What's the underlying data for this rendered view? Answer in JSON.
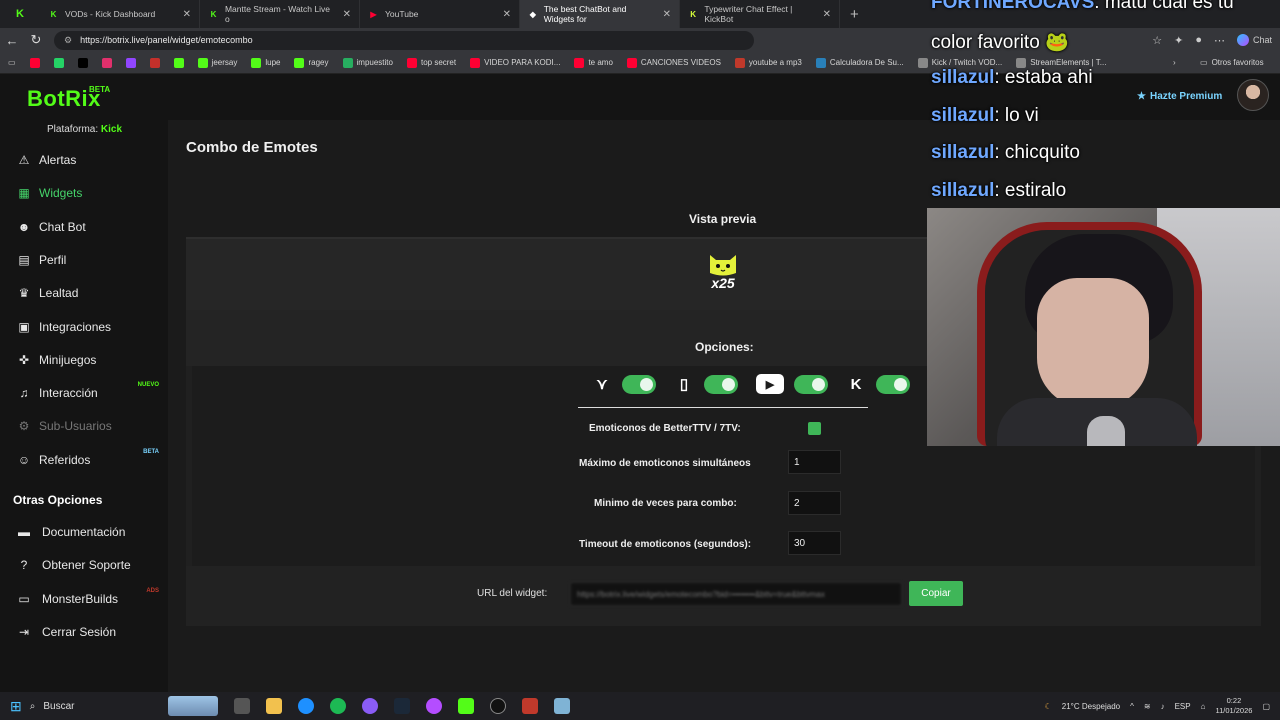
{
  "browser": {
    "tabs": [
      {
        "title": "VODs - Kick Dashboard",
        "icon": "kick-icon",
        "color": "#53fc18",
        "active": false
      },
      {
        "title": "Mantte Stream - Watch Live o",
        "icon": "kick-icon",
        "color": "#53fc18",
        "active": false
      },
      {
        "title": "YouTube",
        "icon": "youtube-icon",
        "color": "#ff0033",
        "active": false
      },
      {
        "title": "The best ChatBot and Widgets for",
        "icon": "botrix-icon",
        "color": "#ffffff",
        "active": true
      },
      {
        "title": "Typewriter Chat Effect | KickBot",
        "icon": "kickbot-icon",
        "color": "#d7ff3a",
        "active": false
      }
    ],
    "url": "https://botrix.live/panel/widget/emotecombo",
    "bookmarks": [
      {
        "label": "",
        "color": "#ff0033"
      },
      {
        "label": "",
        "color": "#25d366"
      },
      {
        "label": "",
        "color": "#000000"
      },
      {
        "label": "",
        "color": "#e1306c"
      },
      {
        "label": "",
        "color": "#9146ff"
      },
      {
        "label": "",
        "color": "#c4302b"
      },
      {
        "label": "",
        "color": "#53fc18"
      },
      {
        "label": "jeersay",
        "color": "#53fc18"
      },
      {
        "label": "lupe",
        "color": "#53fc18"
      },
      {
        "label": "ragey",
        "color": "#53fc18"
      },
      {
        "label": "impuestito",
        "color": "#27ae60"
      },
      {
        "label": "top secret",
        "color": "#ff0033"
      },
      {
        "label": "VIDEO PARA KODI...",
        "color": "#ff0033"
      },
      {
        "label": "te amo",
        "color": "#ff0033"
      },
      {
        "label": "CANCIONES VIDEOS",
        "color": "#ff0033"
      },
      {
        "label": "youtube a mp3",
        "color": "#c0392b"
      },
      {
        "label": "Calculadora De Su...",
        "color": "#2980b9"
      },
      {
        "label": "Kick / Twitch VOD...",
        "color": "#888888"
      },
      {
        "label": "StreamElements | T...",
        "color": "#888888"
      }
    ],
    "other_favorites": "Otros favoritos",
    "chat_button": "Chat"
  },
  "app": {
    "logo": "BotRix",
    "logo_badge": "BETA",
    "premium": "Hazte Premium",
    "platform_label": "Plataforma:",
    "platform_value": "Kick"
  },
  "sidebar": {
    "items": [
      {
        "label": "Alertas",
        "icon": "warning-icon",
        "glyph": "⚠",
        "state": "normal",
        "badge": ""
      },
      {
        "label": "Widgets",
        "icon": "grid-icon",
        "glyph": "▦",
        "state": "active",
        "badge": ""
      },
      {
        "label": "Chat Bot",
        "icon": "robot-icon",
        "glyph": "☻",
        "state": "normal",
        "badge": ""
      },
      {
        "label": "Perfil",
        "icon": "id-card-icon",
        "glyph": "▤",
        "state": "normal",
        "badge": ""
      },
      {
        "label": "Lealtad",
        "icon": "trophy-icon",
        "glyph": "♛",
        "state": "normal",
        "badge": ""
      },
      {
        "label": "Integraciones",
        "icon": "desktop-icon",
        "glyph": "▣",
        "state": "normal",
        "badge": ""
      },
      {
        "label": "Minijuegos",
        "icon": "gamepad-icon",
        "glyph": "✜",
        "state": "normal",
        "badge": ""
      },
      {
        "label": "Interacción",
        "icon": "music-icon",
        "glyph": "♫",
        "state": "normal",
        "badge": "NUEVO",
        "badge_color": "#53fc18"
      },
      {
        "label": "Sub-Usuarios",
        "icon": "users-gear-icon",
        "glyph": "⚙",
        "state": "disabled",
        "badge": ""
      },
      {
        "label": "Referidos",
        "icon": "users-icon",
        "glyph": "☺",
        "state": "normal",
        "badge": "BETA",
        "badge_color": "#7ad4ff"
      }
    ],
    "section_title": "Otras Opciones",
    "other_items": [
      {
        "label": "Documentación",
        "icon": "book-icon",
        "glyph": "▬",
        "badge": ""
      },
      {
        "label": "Obtener Soporte",
        "icon": "help-icon",
        "glyph": "?",
        "badge": ""
      },
      {
        "label": "MonsterBuilds",
        "icon": "laptop-icon",
        "glyph": "▭",
        "badge": "ADS",
        "badge_color": "#c0392b"
      },
      {
        "label": "Cerrar Sesión",
        "icon": "logout-icon",
        "glyph": "⇥",
        "badge": ""
      }
    ]
  },
  "main": {
    "title": "Combo de Emotes",
    "preview_label": "Vista previa",
    "combo_count": "x25",
    "options_label": "Opciones:",
    "platforms": [
      {
        "name": "7tv",
        "icon": "seventv-icon",
        "glyph": "⋎",
        "enabled": true
      },
      {
        "name": "twitch",
        "icon": "twitch-icon",
        "glyph": "▯",
        "enabled": true
      },
      {
        "name": "youtube",
        "icon": "youtube-icon",
        "glyph": "▶",
        "enabled": true
      },
      {
        "name": "kick",
        "icon": "kick-icon",
        "glyph": "K",
        "enabled": true
      }
    ],
    "fields": {
      "bttv_label": "Emoticonos de BetterTTV / 7TV:",
      "max_label": "Máximo de emoticonos simultáneos",
      "max_value": "1",
      "min_label": "Minimo de veces para combo:",
      "min_value": "2",
      "timeout_label": "Timeout de emoticonos (segundos):",
      "timeout_value": "30"
    },
    "url_label": "URL del widget:",
    "url_value": "https://botrix.live/widgets/emotecombo?bid=••••••••&bttv=true&bttvmax",
    "copy_label": "Copiar"
  },
  "overlay": {
    "chat": [
      {
        "user": "FORTINEROCAVS",
        "message": "matu cual es tu"
      },
      {
        "user": "",
        "message": "color favorito 🐸"
      },
      {
        "user": "sillazul",
        "message": "estaba ahi"
      },
      {
        "user": "sillazul",
        "message": "lo vi"
      },
      {
        "user": "sillazul",
        "message": "chicquito"
      },
      {
        "user": "sillazul",
        "message": "estiralo"
      }
    ]
  },
  "taskbar": {
    "search": "Buscar",
    "weather": "21°C  Despejado",
    "lang": "ESP",
    "time": "0:22",
    "date": "11/01/2026"
  }
}
